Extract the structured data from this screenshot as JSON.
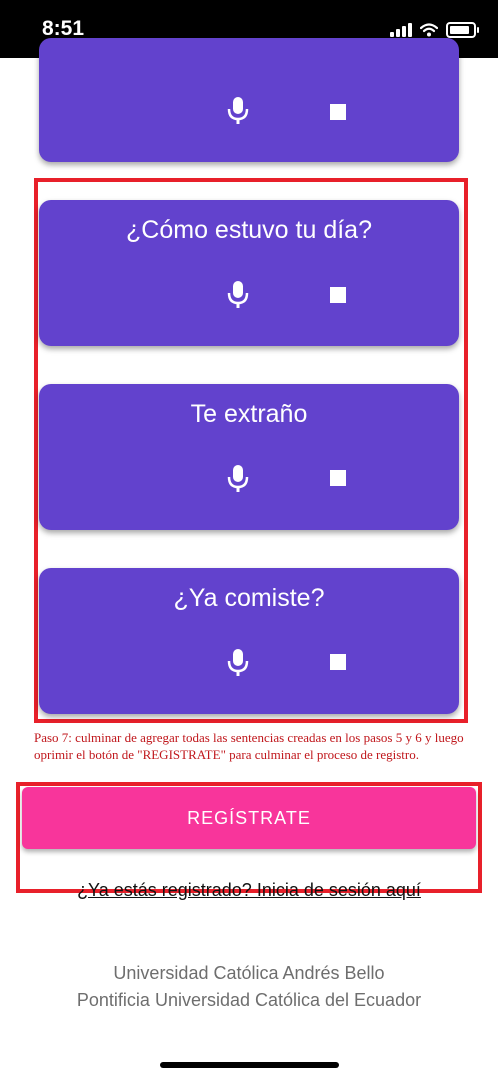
{
  "status_bar": {
    "time": "8:51",
    "battery_level": 0.85
  },
  "cards": [
    {
      "title": ""
    },
    {
      "title": "¿Cómo estuvo tu día?"
    },
    {
      "title": "Te extraño"
    },
    {
      "title": "¿Ya comiste?"
    }
  ],
  "card_icons": [
    "microphone-icon",
    "stop-icon"
  ],
  "instruction": "Paso 7: culminar de agregar todas las sentencias creadas en los pasos 5 y 6 y luego oprimir el botón de \"REGISTRATE\" para culminar el proceso de registro.",
  "register_button": {
    "label": "REGÍSTRATE"
  },
  "login_link": "¿Ya estás registrado? Inicia de sesión aquí",
  "footer": {
    "line1": "Universidad Católica Andrés Bello",
    "line2": "Pontificia Universidad Católica del Ecuador"
  },
  "colors": {
    "card": "#6242cd",
    "register_button": "#f8359b",
    "highlight": "#e8202a",
    "instruction_text": "#c0171c"
  }
}
